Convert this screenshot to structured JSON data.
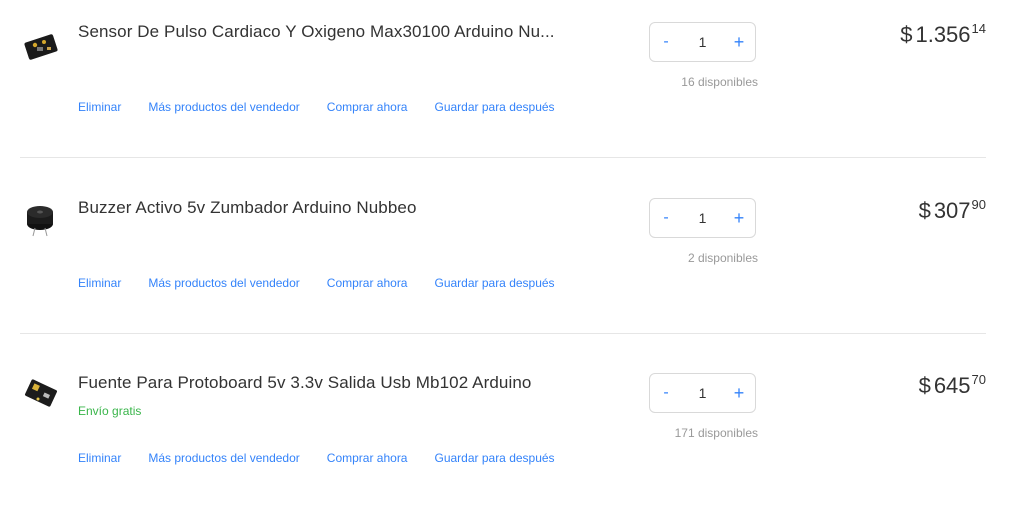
{
  "items": [
    {
      "title": "Sensor De Pulso Cardiaco Y Oxigeno Max30100 Arduino Nu...",
      "shipping": "",
      "quantity": "1",
      "available": "16 disponibles",
      "price_currency": "$",
      "price_whole": "1.356",
      "price_cents": "14",
      "thumb_icon": "pulse-sensor-board-icon"
    },
    {
      "title": "Buzzer Activo 5v Zumbador Arduino Nubbeo",
      "shipping": "",
      "quantity": "1",
      "available": "2 disponibles",
      "price_currency": "$",
      "price_whole": "307",
      "price_cents": "90",
      "thumb_icon": "buzzer-icon"
    },
    {
      "title": "Fuente Para Protoboard 5v 3.3v Salida Usb Mb102 Arduino",
      "shipping": "Envío gratis",
      "quantity": "1",
      "available": "171 disponibles",
      "price_currency": "$",
      "price_whole": "645",
      "price_cents": "70",
      "thumb_icon": "power-supply-board-icon"
    }
  ],
  "actions": {
    "delete": "Eliminar",
    "more_from_seller": "Más productos del vendedor",
    "buy_now": "Comprar ahora",
    "save_for_later": "Guardar para después"
  },
  "stepper": {
    "minus": "-",
    "plus": "+"
  },
  "colors": {
    "link": "#3483fa",
    "shipping": "#39b54a",
    "muted": "#999999"
  }
}
